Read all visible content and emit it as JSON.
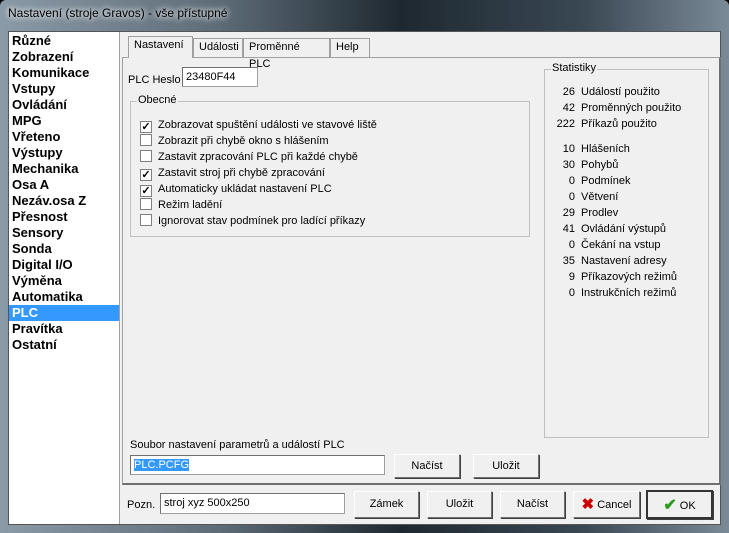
{
  "window": {
    "title": "Nastavení (stroje Gravos) - vše přístupné"
  },
  "sidebar": {
    "items": [
      "Různé",
      "Zobrazení",
      "Komunikace",
      "Vstupy",
      "Ovládání",
      "MPG",
      "Vřeteno",
      "Výstupy",
      "Mechanika",
      "Osa A",
      "Nezáv.osa Z",
      "Přesnost",
      "Sensory",
      "Sonda",
      "Digital I/O",
      "Výměna",
      "Automatika",
      "PLC",
      "Pravítka",
      "Ostatní"
    ],
    "selected": "PLC"
  },
  "tabs": [
    "Nastavení",
    "Události",
    "Proměnné PLC",
    "Help"
  ],
  "active_tab": "Nastavení",
  "plc": {
    "password_label": "PLC Heslo",
    "password_value": "23480F44"
  },
  "general": {
    "legend": "Obecné",
    "options": [
      {
        "label": "Zobrazovat spuštění události ve stavové liště",
        "checked": true
      },
      {
        "label": "Zobrazit při chybě okno s hlášením",
        "checked": false
      },
      {
        "label": "Zastavit zpracování PLC při každé chybě",
        "checked": false
      },
      {
        "label": "Zastavit stroj při chybě zpracování",
        "checked": true
      },
      {
        "label": "Automaticky ukládat nastavení PLC",
        "checked": true
      },
      {
        "label": "Režim ladění",
        "checked": false
      },
      {
        "label": "Ignorovat stav podmínek pro ladící příkazy",
        "checked": false
      }
    ]
  },
  "stats": {
    "legend": "Statistiky",
    "group1": [
      {
        "n": "26",
        "label": "Událostí použito"
      },
      {
        "n": "42",
        "label": "Proměnných použito"
      },
      {
        "n": "222",
        "label": "Příkazů použito"
      }
    ],
    "group2": [
      {
        "n": "10",
        "label": "Hlášeních"
      },
      {
        "n": "30",
        "label": "Pohybů"
      },
      {
        "n": "0",
        "label": "Podmínek"
      },
      {
        "n": "0",
        "label": "Větvení"
      },
      {
        "n": "29",
        "label": "Prodlev"
      },
      {
        "n": "41",
        "label": "Ovládání výstupů"
      },
      {
        "n": "0",
        "label": "Čekání na vstup"
      },
      {
        "n": "35",
        "label": "Nastavení adresy"
      },
      {
        "n": "9",
        "label": "Příkazových režimů"
      },
      {
        "n": "0",
        "label": "Instrukčních režimů"
      }
    ]
  },
  "file": {
    "label": "Soubor nastavení parametrů a událostí PLC",
    "value": "PLC.PCFG",
    "load": "Načíst",
    "save": "Uložit"
  },
  "bottom": {
    "note_label": "Pozn.",
    "note_value": "stroj xyz 500x250",
    "lock": "Zámek",
    "save": "Uložit",
    "load": "Načíst",
    "cancel": "Cancel",
    "ok": "OK"
  },
  "colors": {
    "selection": "#3399ff",
    "cancel_icon": "#cc0000",
    "ok_icon": "#2a9a20"
  }
}
